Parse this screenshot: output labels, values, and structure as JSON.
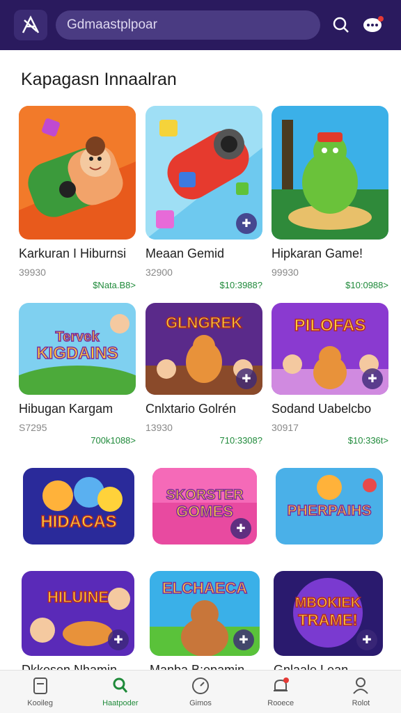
{
  "header": {
    "search_placeholder": "Gdmaastplpoar"
  },
  "section": {
    "title": "Kapagasn Innaalran"
  },
  "games": [
    {
      "name": "Karkuran I Hiburnsi",
      "count": "39930",
      "price": "$Nata.B8>"
    },
    {
      "name": "Meaan Gemid",
      "count": "32900",
      "price": "$10:3988?"
    },
    {
      "name": "Hipkaran Game!",
      "count": "99930",
      "price": "$10:0988>"
    },
    {
      "name": "Hibugan Kargam",
      "count": "S7295",
      "price": "700k1088>"
    },
    {
      "name": "Cnlxtario Golrén",
      "count": "13930",
      "price": "710:3308?"
    },
    {
      "name": "Sodand Uabelcbo",
      "count": "30917",
      "price": "$10:336t>"
    },
    {
      "name": "",
      "count": "",
      "price": ""
    },
    {
      "name": "",
      "count": "",
      "price": ""
    },
    {
      "name": "",
      "count": "",
      "price": ""
    },
    {
      "name": "Dkkesen Nhamin",
      "count": "",
      "price": ""
    },
    {
      "name": "Manba B;epamin",
      "count": "",
      "price": ""
    },
    {
      "name": "Gnlaale Lean",
      "count": "",
      "price": ""
    }
  ],
  "thumb_text": {
    "g4": "Tervek KIGDAINS",
    "g5": "GLNGREK",
    "g6": "PILOFAS",
    "g7": "HIDACAS",
    "g8": "SKORSTER GOMES",
    "g9": "PHERPAIHS",
    "g10": "HILUINE",
    "g11": "ELCHAECA",
    "g12": "MBOKIEK TRAME!"
  },
  "tabs": [
    {
      "label": "Kooileg",
      "icon": "bookmark-icon"
    },
    {
      "label": "Haatpoder",
      "icon": "search-icon"
    },
    {
      "label": "Gimos",
      "icon": "gauge-icon"
    },
    {
      "label": "Rooece",
      "icon": "bell-icon"
    },
    {
      "label": "Rolot",
      "icon": "user-icon"
    }
  ],
  "colors": {
    "header_bg": "#2a1a5e",
    "price_green": "#1f8a3a",
    "active_tab": "#1f8a3a"
  }
}
